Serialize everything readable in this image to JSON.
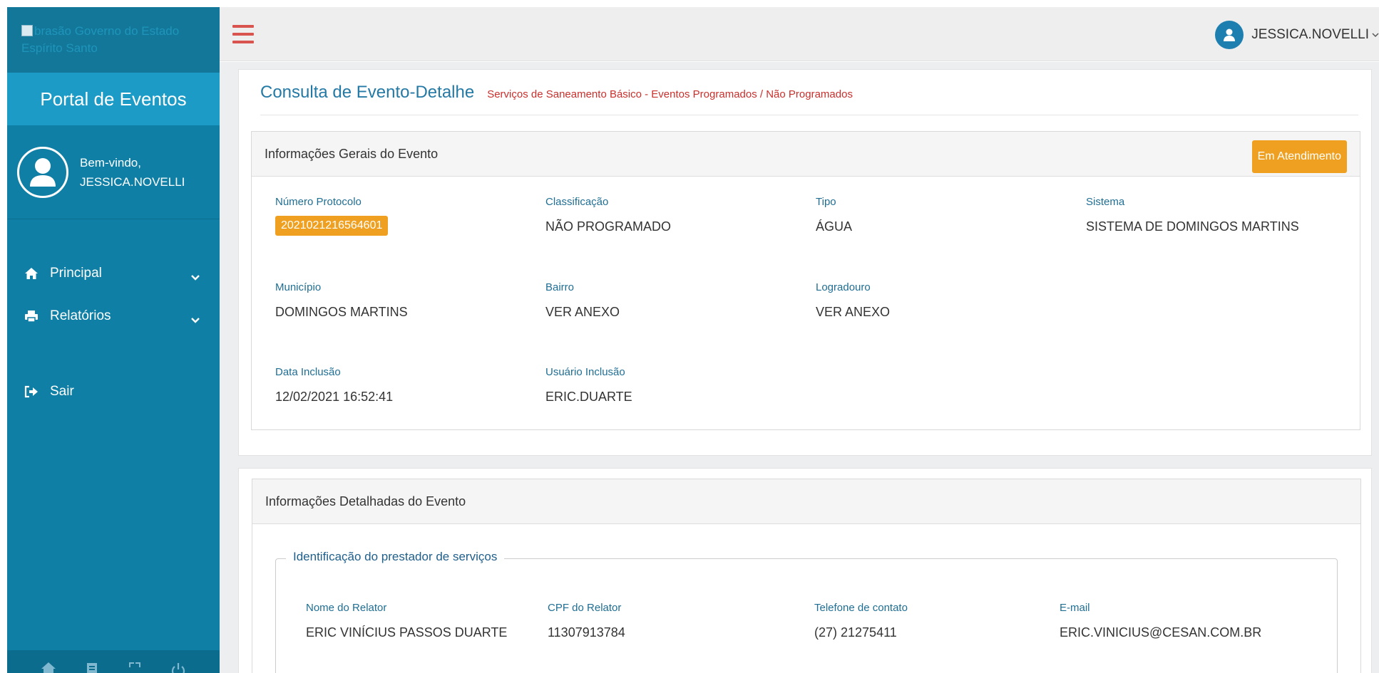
{
  "sidebar": {
    "logo_alt": "brasão Governo do Estado Espírito Santo",
    "title": "Portal de Eventos",
    "welcome": "Bem-vindo,",
    "username": "JESSICA.NOVELLI",
    "nav": [
      {
        "label": "Principal",
        "icon": "home-icon"
      },
      {
        "label": "Relatórios",
        "icon": "print-icon"
      },
      {
        "label": "Sair",
        "icon": "sign-out-icon"
      }
    ],
    "footer_icons": [
      "home-icon",
      "document-icon",
      "expand-icon",
      "power-icon"
    ]
  },
  "topbar": {
    "username": "JESSICA.NOVELLI"
  },
  "page": {
    "title": "Consulta de Evento-Detalhe",
    "subtitle": "Serviços de Saneamento Básico - Eventos Programados / Não Programados"
  },
  "general_info": {
    "header": "Informações Gerais do Evento",
    "status": "Em Atendimento",
    "fields": {
      "protocolo": {
        "label": "Número Protocolo",
        "value": "2021021216564601"
      },
      "classificacao": {
        "label": "Classificação",
        "value": "NÃO PROGRAMADO"
      },
      "tipo": {
        "label": "Tipo",
        "value": "ÁGUA"
      },
      "sistema": {
        "label": "Sistema",
        "value": "SISTEMA DE DOMINGOS MARTINS"
      },
      "municipio": {
        "label": "Município",
        "value": "DOMINGOS MARTINS"
      },
      "bairro": {
        "label": "Bairro",
        "value": "VER ANEXO"
      },
      "logradouro": {
        "label": "Logradouro",
        "value": "VER ANEXO"
      },
      "data_inclusao": {
        "label": "Data Inclusão",
        "value": "12/02/2021 16:52:41"
      },
      "usuario_inclusao": {
        "label": "Usuário Inclusão",
        "value": "ERIC.DUARTE"
      }
    }
  },
  "detailed_info": {
    "header": "Informações Detalhadas do Evento",
    "fieldset_legend": "Identificação do prestador de serviços",
    "fields": {
      "nome": {
        "label": "Nome do Relator",
        "value": "ERIC VINÍCIUS PASSOS DUARTE"
      },
      "cpf": {
        "label": "CPF do Relator",
        "value": "11307913784"
      },
      "telefone": {
        "label": "Telefone de contato",
        "value": "(27) 21275411"
      },
      "email": {
        "label": "E-mail",
        "value": "ERIC.VINICIUS@CESAN.COM.BR"
      }
    }
  },
  "colors": {
    "sidebar": "#0f7fa5",
    "sidebar_title": "#1c9bc7",
    "accent_orange": "#f0a020",
    "title_blue": "#2479a5",
    "subtitle_red": "#c9302c"
  }
}
